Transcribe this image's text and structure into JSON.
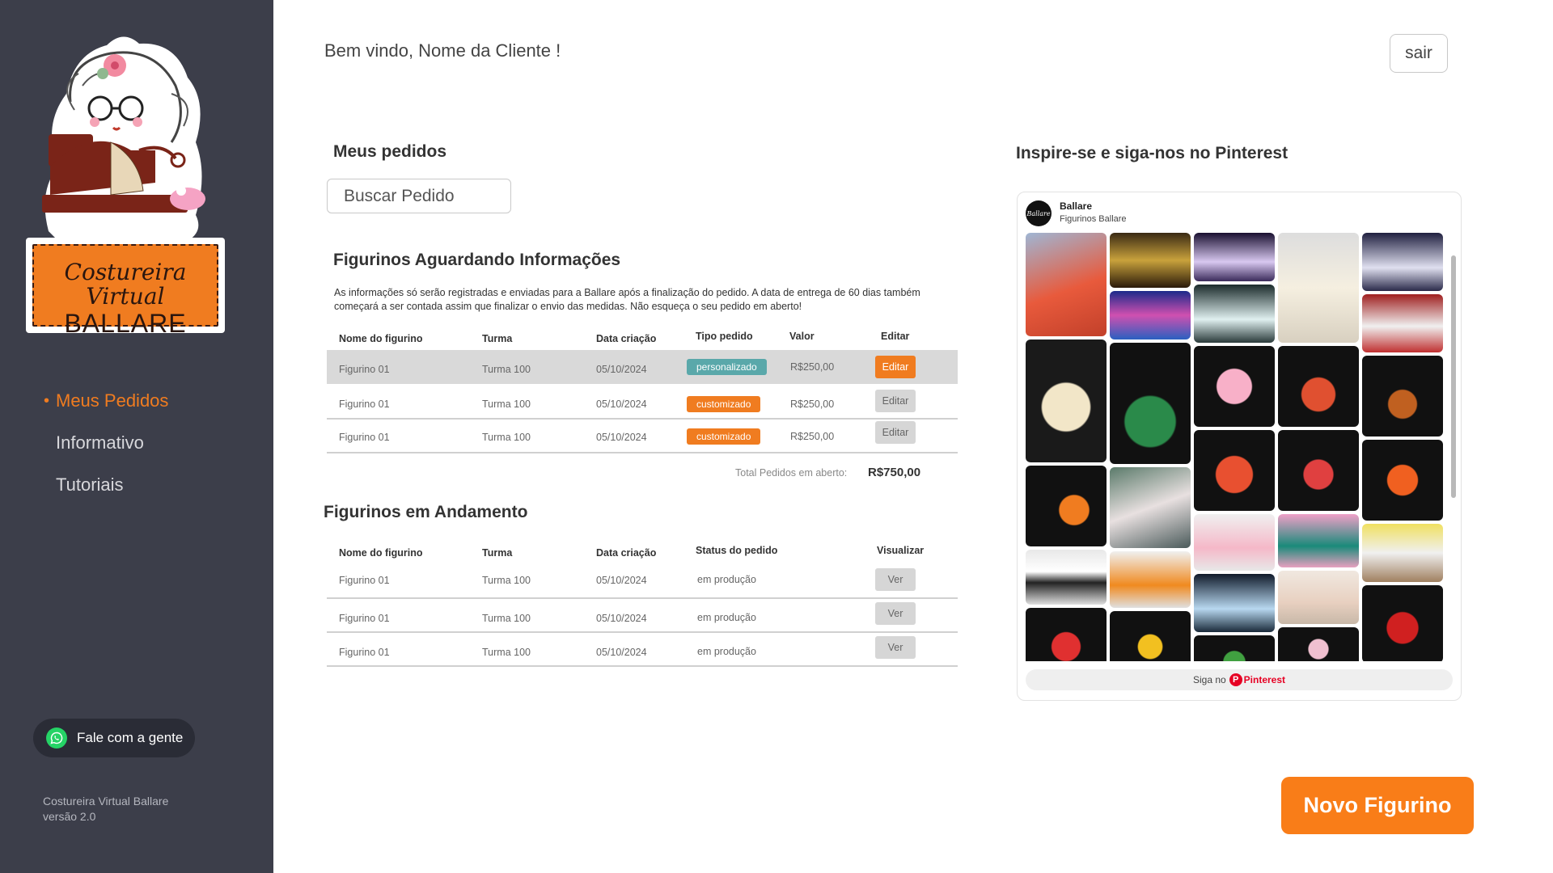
{
  "brand": {
    "script_name": "Costureira Virtual",
    "name": "BALLARE"
  },
  "sidebar": {
    "items": [
      {
        "label": "Meus Pedidos",
        "active": true
      },
      {
        "label": "Informativo",
        "active": false
      },
      {
        "label": "Tutoriais",
        "active": false
      }
    ],
    "whatsapp_label": "Fale com a gente",
    "footer_line1": "Costureira Virtual Ballare",
    "footer_line2": "versão 2.0"
  },
  "header": {
    "welcome": "Bem vindo, Nome da Cliente !",
    "logout_label": "sair"
  },
  "orders": {
    "title": "Meus pedidos",
    "search_placeholder": "Buscar Pedido"
  },
  "awaiting": {
    "title": "Figurinos Aguardando Informações",
    "info": "As informações só serão registradas e enviadas para a Ballare após a finalização do pedido. A data de entrega de 60 dias também começará a ser contada assim que finalizar o envio das medidas. Não esqueça o seu pedido em aberto!",
    "columns": [
      "Nome do figurino",
      "Turma",
      "Data criação",
      "Tipo pedido",
      "Valor",
      "Editar"
    ],
    "rows": [
      {
        "name": "Figurino 01",
        "turma": "Turma 100",
        "date": "05/10/2024",
        "type": "personalizado",
        "value": "R$250,00",
        "action": "Editar"
      },
      {
        "name": "Figurino 01",
        "turma": "Turma 100",
        "date": "05/10/2024",
        "type": "customizado",
        "value": "R$250,00",
        "action": "Editar"
      },
      {
        "name": "Figurino 01",
        "turma": "Turma 100",
        "date": "05/10/2024",
        "type": "customizado",
        "value": "R$250,00",
        "action": "Editar"
      }
    ],
    "total_label": "Total Pedidos em aberto:",
    "total_value": "R$750,00"
  },
  "progress": {
    "title": "Figurinos em Andamento",
    "columns": [
      "Nome do figurino",
      "Turma",
      "Data criação",
      "Status do pedido",
      "Visualizar"
    ],
    "rows": [
      {
        "name": "Figurino 01",
        "turma": "Turma 100",
        "date": "05/10/2024",
        "status": "em produção",
        "action": "Ver"
      },
      {
        "name": "Figurino 01",
        "turma": "Turma 100",
        "date": "05/10/2024",
        "status": "em produção",
        "action": "Ver"
      },
      {
        "name": "Figurino 01",
        "turma": "Turma 100",
        "date": "05/10/2024",
        "status": "em produção",
        "action": "Ver"
      }
    ]
  },
  "pinterest": {
    "title": "Inspire-se e siga-nos no Pinterest",
    "profile_name": "Ballare",
    "board_name": "Figurinos Ballare",
    "avatar_text": "Ballare",
    "follow_prefix": "Siga no",
    "follow_brand": "Pinterest"
  },
  "cta": {
    "label": "Novo Figurino"
  },
  "colors": {
    "sidebar_bg": "#3c3e4a",
    "accent_orange": "#f07c20",
    "badge_teal": "#5aa8aa",
    "pinterest_red": "#e60023"
  }
}
